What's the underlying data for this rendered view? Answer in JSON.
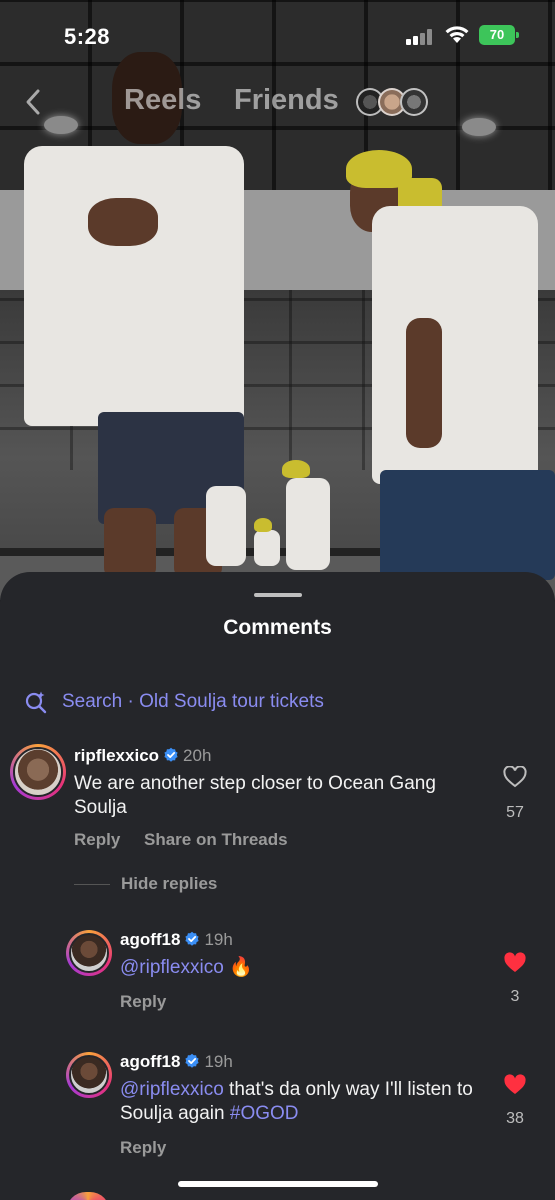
{
  "status_bar": {
    "time": "5:28",
    "battery": "70"
  },
  "nav": {
    "tabs": [
      {
        "label": "Reels"
      },
      {
        "label": "Friends"
      }
    ]
  },
  "sheet": {
    "title": "Comments",
    "search": "Search · Old Soulja tour tickets"
  },
  "comments": [
    {
      "username": "ripflexxico",
      "time": "20h",
      "text": "We are another step closer to Ocean Gang Soulja",
      "reply_label": "Reply",
      "share_label": "Share on Threads",
      "likes": "57",
      "liked": false
    }
  ],
  "hide_replies": "Hide replies",
  "replies": [
    {
      "username": "agoff18",
      "time": "19h",
      "mention": "@ripflexxico",
      "text": " 🔥",
      "reply_label": "Reply",
      "likes": "3",
      "liked": true
    },
    {
      "username": "agoff18",
      "time": "19h",
      "mention": "@ripflexxico",
      "text": " that's da only way I'll listen to Soulja again ",
      "hashtag": "#OGOD",
      "reply_label": "Reply",
      "likes": "38",
      "liked": true
    }
  ],
  "colors": {
    "sheet_bg": "#25262a",
    "accent_link": "#8a8cf0",
    "like_red": "#ff3040",
    "battery_green": "#3dc55a"
  }
}
